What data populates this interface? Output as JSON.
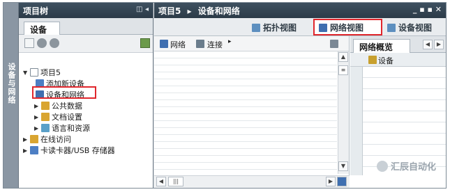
{
  "side_tab": {
    "label": "设备与网络"
  },
  "tree": {
    "title": "项目树",
    "header_controls": "◫ ◂",
    "tab_devices": "设备",
    "items": [
      {
        "label": "项目5"
      },
      {
        "label": "添加新设备"
      },
      {
        "label": "设备和网络"
      },
      {
        "label": "公共数据"
      },
      {
        "label": "文档设置"
      },
      {
        "label": "语言和资源"
      },
      {
        "label": "在线访问"
      },
      {
        "label": "卡读卡器/USB 存储器"
      }
    ]
  },
  "main": {
    "breadcrumb_project": "项目5",
    "breadcrumb_sep": "▸",
    "breadcrumb_page": "设备和网络",
    "window_controls": "_ ▪ ▪ ✕",
    "views": {
      "topology": "拓扑视图",
      "network": "网络视图",
      "device": "设备视图"
    },
    "canvas_toolbar": {
      "network": "网络",
      "connections": "连接",
      "caret": "▸"
    },
    "overview": {
      "tab": "网络概览",
      "column_device": "设备"
    }
  },
  "watermark": "汇辰自动化",
  "colors": {
    "highlight_red": "#e0262c",
    "header_dark": "#2c3b48",
    "side_tab": "#8a96a3"
  }
}
